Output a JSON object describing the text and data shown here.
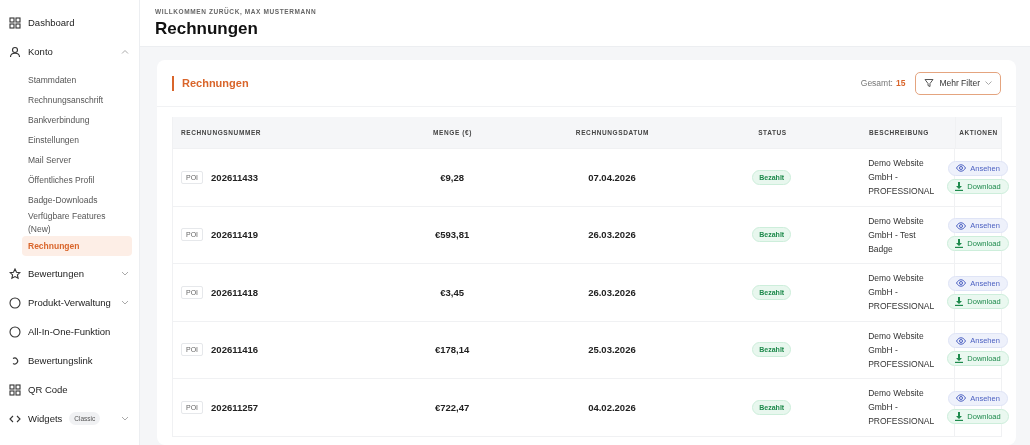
{
  "sidebar": {
    "items": [
      {
        "label": "Dashboard"
      },
      {
        "label": "Konto",
        "expanded": true,
        "children": [
          {
            "label": "Stammdaten",
            "selected": false
          },
          {
            "label": "Rechnungsanschrift",
            "selected": false
          },
          {
            "label": "Bankverbindung",
            "selected": false
          },
          {
            "label": "Einstellungen",
            "selected": false
          },
          {
            "label": "Mail Server",
            "selected": false
          },
          {
            "label": "Öffentliches Profil",
            "selected": false
          },
          {
            "label": "Badge-Downloads",
            "selected": false
          },
          {
            "label": "Verfügbare Features (New)",
            "selected": false
          },
          {
            "label": "Rechnungen",
            "selected": true
          }
        ]
      },
      {
        "label": "Bewertungen",
        "expanded": false
      },
      {
        "label": "Produkt-Verwaltung",
        "expanded": false
      },
      {
        "label": "All-In-One-Funktion"
      },
      {
        "label": "Bewertungslink"
      },
      {
        "label": "QR Code"
      },
      {
        "label": "Widgets",
        "badge": "Classic",
        "expanded": false
      }
    ]
  },
  "header": {
    "greeting": "WILLKOMMEN ZURÜCK, MAX MUSTERMANN",
    "title": "Rechnungen"
  },
  "card": {
    "title": "Rechnungen",
    "total_label": "Gesamt:",
    "total": "15",
    "filter_button": "Mehr Filter"
  },
  "table": {
    "columns": [
      "RECHNUNGSNUMMER",
      "MENGE (€)",
      "RECHNUNGSDATUM",
      "STATUS",
      "BESCHREIBUNG",
      "AKTIONEN"
    ],
    "rows": [
      {
        "tag": "POI",
        "number": "202611433",
        "amount": "€9,28",
        "date": "07.04.2026",
        "status": "Bezahlt",
        "description": "Demo Website GmbH - PROFESSIONAL",
        "view": "Ansehen",
        "download": "Download"
      },
      {
        "tag": "POI",
        "number": "202611419",
        "amount": "€593,81",
        "date": "26.03.2026",
        "status": "Bezahlt",
        "description": "Demo Website GmbH - Test Badge",
        "view": "Ansehen",
        "download": "Download"
      },
      {
        "tag": "POI",
        "number": "202611418",
        "amount": "€3,45",
        "date": "26.03.2026",
        "status": "Bezahlt",
        "description": "Demo Website GmbH - PROFESSIONAL",
        "view": "Ansehen",
        "download": "Download"
      },
      {
        "tag": "POI",
        "number": "202611416",
        "amount": "€178,14",
        "date": "25.03.2026",
        "status": "Bezahlt",
        "description": "Demo Website GmbH - PROFESSIONAL",
        "view": "Ansehen",
        "download": "Download"
      },
      {
        "tag": "POI",
        "number": "202611257",
        "amount": "€722,47",
        "date": "04.02.2026",
        "status": "Bezahlt",
        "description": "Demo Website GmbH - PROFESSIONAL",
        "view": "Ansehen",
        "download": "Download"
      }
    ]
  }
}
